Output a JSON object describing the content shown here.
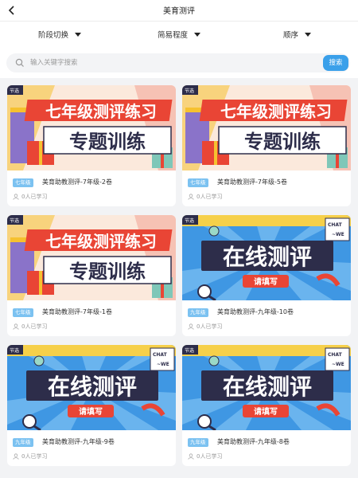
{
  "header": {
    "title": "美育测评",
    "back_icon": "chevron-left-icon"
  },
  "filters": [
    {
      "label": "阶段切换"
    },
    {
      "label": "简易程度"
    },
    {
      "label": "顺序"
    }
  ],
  "search": {
    "placeholder": "输入关键字搜索",
    "value": "",
    "button": "搜索"
  },
  "banners": {
    "practice": {
      "line1": "七年级测评练习",
      "line2": "专题训练",
      "corner": "节选"
    },
    "online": {
      "main": "在线测评",
      "sub": "请填写",
      "bubble": "CHAT",
      "bubble2": "~WE",
      "corner": "节选"
    }
  },
  "cards": [
    {
      "tag": "七年级",
      "title": "美育助教测评-7年级-2卷",
      "learners": "0人已学习",
      "cover": "practice"
    },
    {
      "tag": "七年级",
      "title": "美育助教测评-7年级-5卷",
      "learners": "0人已学习",
      "cover": "practice"
    },
    {
      "tag": "七年级",
      "title": "美育助教测评-7年级-1卷",
      "learners": "0人已学习",
      "cover": "practice"
    },
    {
      "tag": "九年级",
      "title": "美育助教测评-九年级-10卷",
      "learners": "0人已学习",
      "cover": "online"
    },
    {
      "tag": "九年级",
      "title": "美育助教测评-九年级-9卷",
      "learners": "0人已学习",
      "cover": "online"
    },
    {
      "tag": "九年级",
      "title": "美育助教测评-九年级-8卷",
      "learners": "0人已学习",
      "cover": "online"
    }
  ],
  "colors": {
    "accent": "#3aa0ea",
    "tag": "#7cc2f1",
    "banner_red": "#e94535",
    "banner_yellow": "#f6c12f",
    "banner_blue": "#3f97e3"
  }
}
